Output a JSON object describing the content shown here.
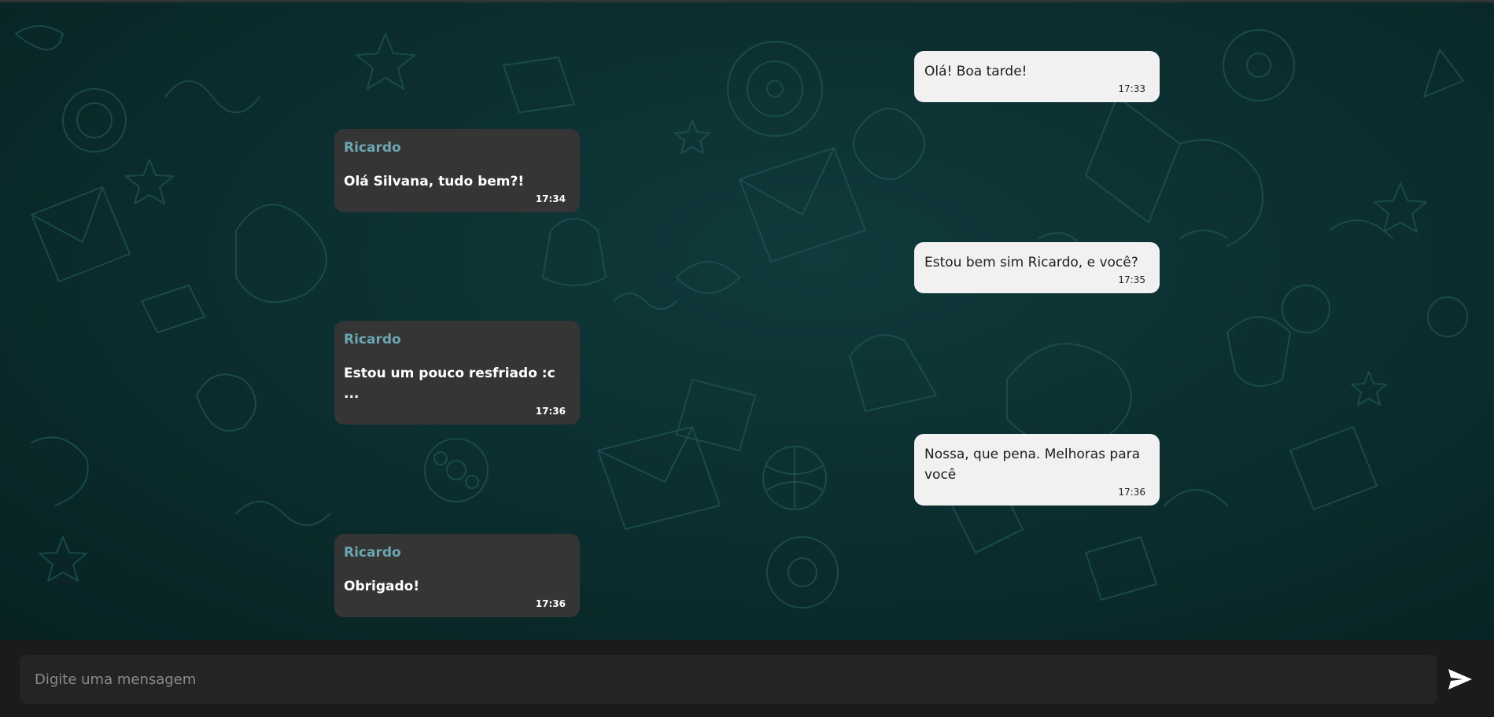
{
  "colors": {
    "background": "#0b2b2c",
    "received_bubble": "#353535",
    "sent_bubble": "#f1f1f1",
    "sender_name": "#6aa6b0",
    "input_bar": "#1b1b1b"
  },
  "messages": [
    {
      "direction": "sent",
      "text": "Olá! Boa tarde!",
      "time": "17:33"
    },
    {
      "direction": "received",
      "sender": "Ricardo",
      "text": "Olá Silvana, tudo bem?!",
      "time": "17:34"
    },
    {
      "direction": "sent",
      "text": "Estou bem sim Ricardo, e você?",
      "time": "17:35"
    },
    {
      "direction": "received",
      "sender": "Ricardo",
      "text": "Estou um pouco resfriado :c ...",
      "time": "17:36"
    },
    {
      "direction": "sent",
      "text": "Nossa, que pena. Melhoras para você",
      "time": "17:36"
    },
    {
      "direction": "received",
      "sender": "Ricardo",
      "text": "Obrigado!",
      "time": "17:36"
    }
  ],
  "composer": {
    "placeholder": "Digite uma mensagem",
    "value": "",
    "send_icon": "send-icon"
  }
}
